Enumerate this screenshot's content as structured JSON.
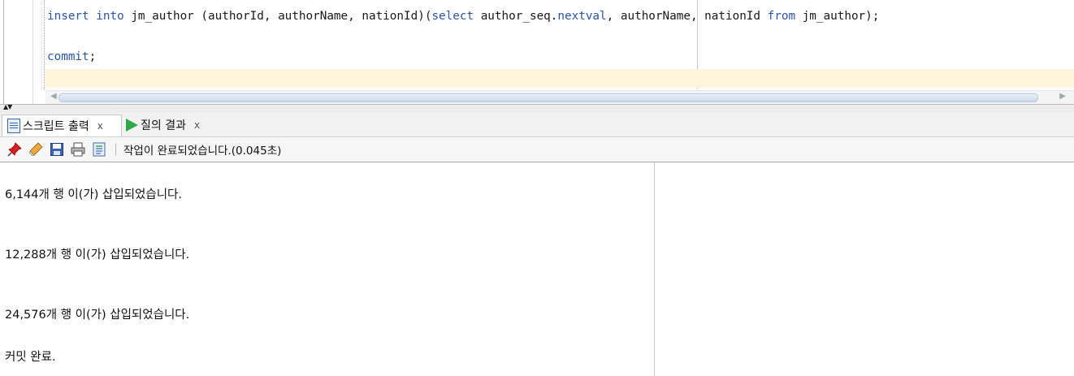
{
  "editor": {
    "line1": {
      "kw_insert": "insert",
      "kw_into": "into",
      "part_table": "jm_author (authorId, authorName, nationId)(",
      "kw_select": "select",
      "part_seq": "author_seq.",
      "kw_nextval": "nextval",
      "part_cols": ", authorName, nationId ",
      "kw_from": "from",
      "part_end": "jm_author);"
    },
    "line2": {
      "kw_commit": "commit",
      "part_end": ";"
    }
  },
  "splitter": {
    "arrows": "▲▼"
  },
  "tabs": [
    {
      "label": "스크립트 출력",
      "close": "x",
      "icon": "script-output-icon",
      "active": true
    },
    {
      "label": "질의 결과",
      "close": "x",
      "icon": "run-icon",
      "active": false
    }
  ],
  "toolbar": {
    "icons": [
      "pin-icon",
      "eraser-icon",
      "save-icon",
      "print-icon",
      "document-icon"
    ],
    "status": "작업이 완료되었습니다.(0.045초)"
  },
  "output": {
    "lines": [
      {
        "count": "6,144",
        "text": "개 행 이(가) 삽입되었습니다."
      },
      {
        "count": "12,288",
        "text": "개 행 이(가) 삽입되었습니다."
      },
      {
        "count": "24,576",
        "text": "개 행 이(가) 삽입되었습니다."
      }
    ],
    "commit": "커밋 완료."
  },
  "colors": {
    "keyword": "#2e54a8",
    "current_line": "#fdf5dc",
    "run_icon": "#2fa84a"
  }
}
